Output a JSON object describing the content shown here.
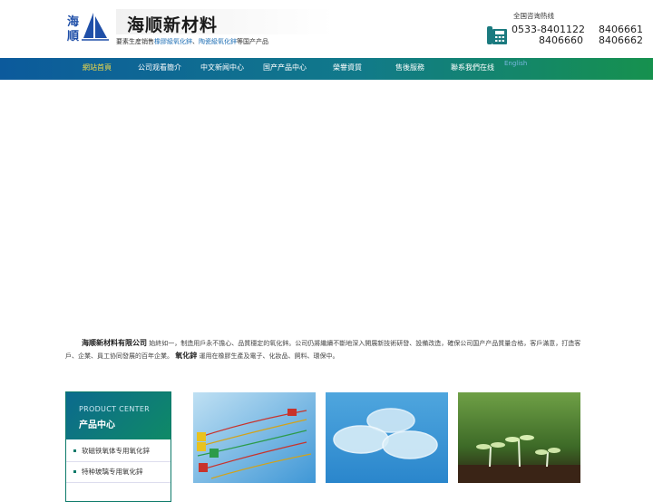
{
  "header": {
    "brand": "海顺新材料",
    "tagline_prefix": "要素生産销售",
    "tagline_link1": "橡膠級氧化鋅",
    "tagline_sep": "、",
    "tagline_link2": "陶瓷級氧化鋅",
    "tagline_suffix": "等国产产品",
    "hotline_label": "全国咨询热线",
    "phones": [
      "0533-8401122",
      "8406661",
      "8406660",
      "8406662"
    ]
  },
  "nav": {
    "items": [
      "網站首頁",
      "公司观看簡介",
      "中文新闻中心",
      "国产产品中心",
      "榮譽資質",
      "售後服務",
      "聯系我們在线"
    ],
    "english": "English"
  },
  "intro": {
    "company": "海顺新材料有限公司",
    "text1": "始終如一，制造用戶永不擔心、品質穩定的氧化鋅。公司仍將繼續不斷地深入開展新技術研發、設備改造，確保公司国产产品質量合格，客戶滿意，打造客戶、企業、員工协同發展的百年企業。",
    "keyword": "氧化鋅",
    "text2": "運用在橡膠生產及電子、化妝品、飼料、環保中。"
  },
  "sidebar": {
    "title_en": "PRODUCT CENTER",
    "title_cn": "产品中心",
    "items": [
      "软磁铁氧体专用氧化鋅",
      "特种玻璃专用氧化鋅"
    ]
  },
  "colors": {
    "nav_start": "#0c5a9c",
    "nav_end": "#16914e",
    "accent": "#f3dc4a"
  },
  "icons": {
    "logo": "sailboat-logo-icon",
    "phone": "telephone-icon"
  }
}
